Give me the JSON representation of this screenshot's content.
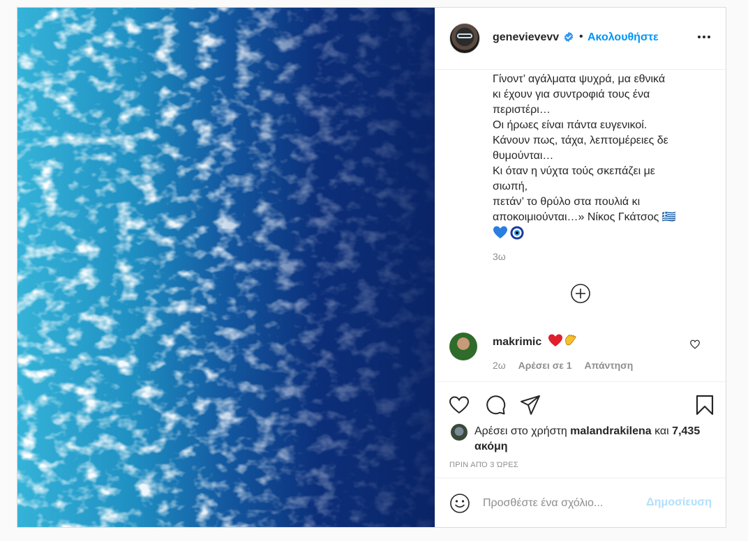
{
  "post": {
    "username": "genevievevv",
    "follow_label": "Ακολουθήστε",
    "separator": "•",
    "caption_lines": "Γίνοντ’ αγάλματα ψυχρά, μα εθνικά\nκι έχουν για συντροφιά τους ένα\nπεριστέρι…\nΟι ήρωες είναι πάντα ευγενικοί.\nΚάνουν πως, τάχα, λεπτομέρειες δε\nθυμούνται…\nΚι όταν η νύχτα τούς σκεπάζει με\nσιωπή,\nπετάν’ το θρύλο στα πουλιά κι\nαποκοιμιούνται…» Νίκος Γκάτσος 🇬🇷",
    "caption_time": "3ω",
    "caption_emojis": "💙🧿"
  },
  "comment": {
    "username": "makrimic",
    "emojis": "❤️👏",
    "time": "2ω",
    "likes": "Αρέσει σε 1",
    "reply": "Απάντηση"
  },
  "likes": {
    "prefix": "Αρέσει στο χρήστη ",
    "user": "malandrakilena",
    "middle": " και ",
    "count": "7,435 ακόμη"
  },
  "post_time": "ΠΡΙΝ ΑΠΌ 3 ΏΡΕΣ",
  "comment_box": {
    "placeholder": "Προσθέστε ένα σχόλιο...",
    "post_label": "Δημοσίευση"
  },
  "icons": {
    "more": "more-options-icon",
    "verified": "verified-badge-icon",
    "add": "load-more-comments-icon",
    "like": "heart-icon",
    "comment": "comment-icon",
    "share": "share-icon",
    "save": "bookmark-icon",
    "emoji": "emoji-icon"
  },
  "colors": {
    "accent": "#0095f6",
    "post_button_disabled": "#b2dffc",
    "muted": "#8e8e8e"
  }
}
